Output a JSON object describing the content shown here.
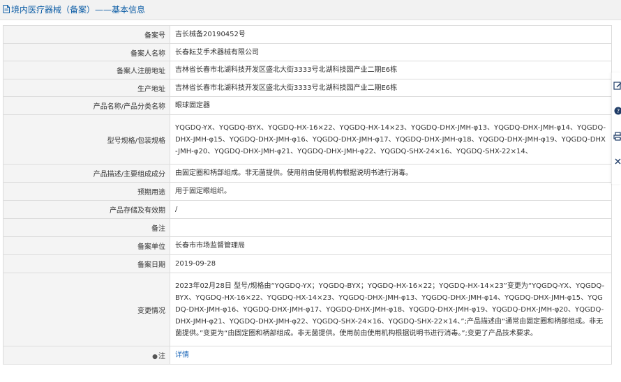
{
  "header": {
    "title": "境内医疗器械（备案）——基本信息"
  },
  "rows": [
    {
      "label": "备案号",
      "value": "吉长械备20190452号"
    },
    {
      "label": "备案人名称",
      "value": "长春耘艾手术器械有限公司"
    },
    {
      "label": "备案人注册地址",
      "value": "吉林省长春市北湖科技开发区盛北大街3333号北湖科技园产业二期E6栋"
    },
    {
      "label": "生产地址",
      "value": "吉林省长春市北湖科技开发区盛北大街3333号北湖科技园产业二期E6栋"
    },
    {
      "label": "产品名称/产品分类名称",
      "value": "眼球固定器"
    },
    {
      "label": "型号规格/包装规格",
      "value": "YQGDQ-YX、YQGDQ-BYX、YQGDQ-HX-16×22、YQGDQ-HX-14×23、YQGDQ-DHX-JMH-φ13、YQGDQ-DHX-JMH-φ14、YQGDQ-DHX-JMH-φ15、YQGDQ-DHX-JMH-φ16、YQGDQ-DHX-JMH-φ17、YQGDQ-DHX-JMH-φ18、YQGDQ-DHX-JMH-φ19、YQGDQ-DHX-JMH-φ20、YQGDQ-DHX-JMH-φ21、YQGDQ-DHX-JMH-φ22、YQGDQ-SHX-24×16、YQGDQ-SHX-22×14、"
    },
    {
      "label": "产品描述/主要组成成分",
      "value": "由固定圈和柄部组成。非无菌提供。使用前由使用机构根据说明书进行消毒。"
    },
    {
      "label": "预期用途",
      "value": "用于固定眼组织。"
    },
    {
      "label": "产品存储及有效期",
      "value": "/"
    },
    {
      "label": "备注",
      "value": ""
    },
    {
      "label": "备案单位",
      "value": "长春市市场监督管理局"
    },
    {
      "label": "备案日期",
      "value": "2019-09-28"
    },
    {
      "label": "变更情况",
      "value": "2023年02月28日 型号/规格由“YQGDQ-YX；YQGDQ-BYX；YQGDQ-HX-16×22；YQGDQ-HX-14×23”变更为“YQGDQ-YX、YQGDQ-BYX、YQGDQ-HX-16×22、YQGDQ-HX-14×23、YQGDQ-DHX-JMH-φ13、YQGDQ-DHX-JMH-φ14、YQGDQ-DHX-JMH-φ15、YQGDQ-DHX-JMH-φ16、YQGDQ-DHX-JMH-φ17、YQGDQ-DHX-JMH-φ18、YQGDQ-DHX-JMH-φ19、YQGDQ-DHX-JMH-φ20、YQGDQ-DHX-JMH-φ21、YQGDQ-DHX-JMH-φ22、YQGDQ-SHX-24×16、YQGDQ-SHX-22×14、”;产品描述由“通常由固定圈和柄部组成。非无菌提供。”变更为“由固定圈和柄部组成。非无菌提供。使用前由使用机构根据说明书进行消毒。”;变更了产品技术要求。"
    }
  ],
  "note": {
    "label": "注",
    "link_text": "详情"
  },
  "icons": {
    "header": "document-icon",
    "note": "pin-icon",
    "side_tools": [
      "edit-icon",
      "help-icon",
      "print-icon",
      "close-icon"
    ]
  },
  "colors": {
    "header_bg": "#f2f2f2",
    "header_text": "#0e5ea6",
    "label_bg": "#f4f4f4",
    "border": "#dcdcdc",
    "link": "#1a66b8"
  }
}
